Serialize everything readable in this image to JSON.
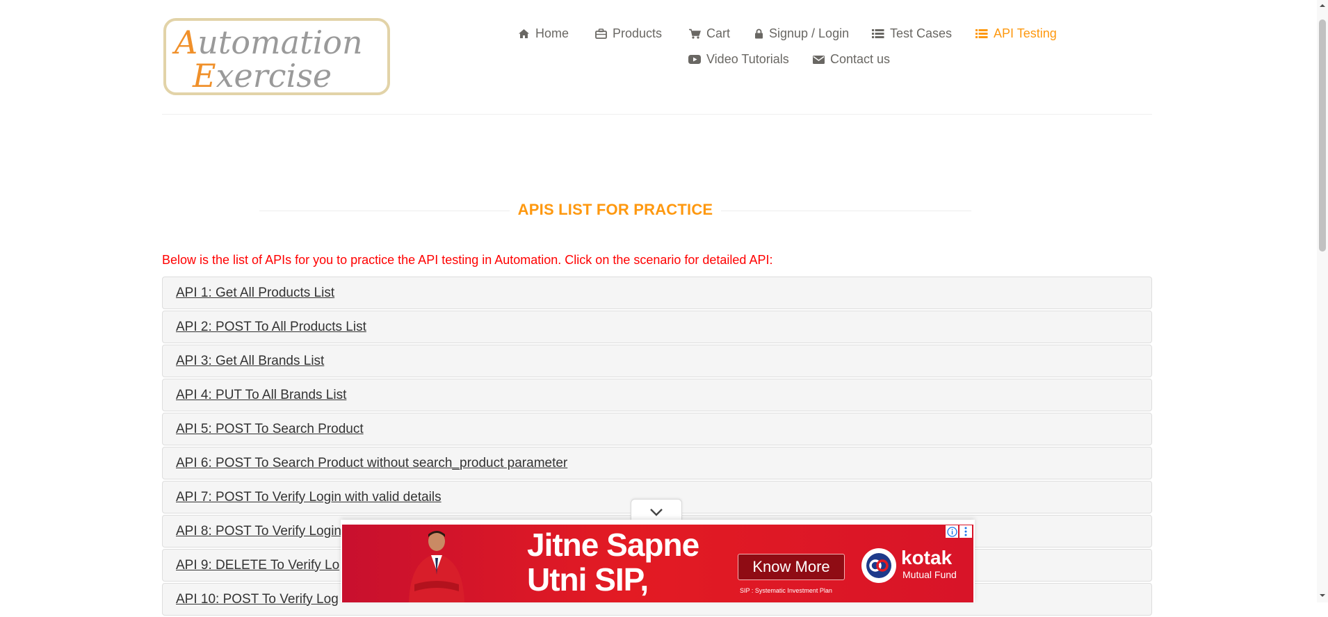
{
  "logo": {
    "line1_initial": "A",
    "line1_rest": "utomation",
    "line2_initial": "E",
    "line2_rest": "xercise"
  },
  "nav": {
    "items": [
      {
        "label": "Home",
        "icon": "home-icon"
      },
      {
        "label": "Products",
        "icon": "briefcase-icon"
      },
      {
        "label": "Cart",
        "icon": "cart-icon"
      },
      {
        "label": "Signup / Login",
        "icon": "lock-icon"
      },
      {
        "label": "Test Cases",
        "icon": "list-icon"
      },
      {
        "label": "API Testing",
        "icon": "list-icon",
        "active": true
      },
      {
        "label": "Video Tutorials",
        "icon": "youtube-play-icon"
      },
      {
        "label": "Contact us",
        "icon": "envelope-icon"
      }
    ],
    "active_color": "#fe980f"
  },
  "main": {
    "title": "APIS LIST FOR PRACTICE",
    "intro": "Below is the list of APIs for you to practice the API testing in Automation. Click on the scenario for detailed API:",
    "apis": [
      "API 1: Get All Products List",
      "API 2: POST To All Products List",
      "API 3: Get All Brands List",
      "API 4: PUT To All Brands List",
      "API 5: POST To Search Product",
      "API 6: POST To Search Product without search_product parameter",
      "API 7: POST To Verify Login with valid details",
      "API 8: POST To Verify Login",
      "API 9: DELETE To Verify Lo",
      "API 10: POST To Verify Log"
    ]
  },
  "ad": {
    "headline_line1": "Jitne Sapne",
    "headline_line2": "Utni SIP,",
    "cta": "Know More",
    "footnote": "SIP : Systematic Investment Plan",
    "brand": "kotak",
    "brand_sub": "Mutual Fund",
    "background": "#e31b23"
  }
}
